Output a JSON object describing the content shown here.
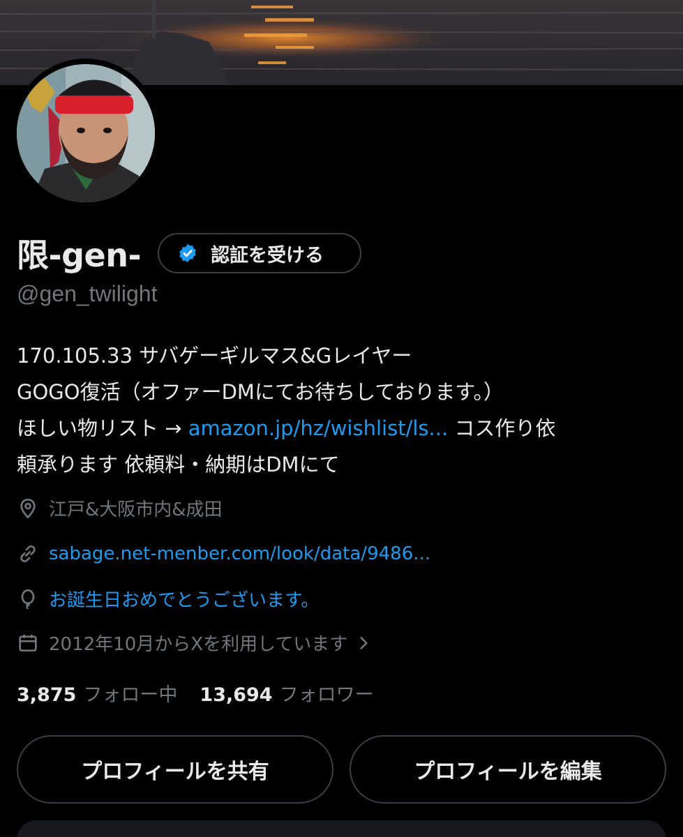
{
  "profile": {
    "display_name": "限-gen-",
    "verify_button_label": "認証を受ける",
    "handle": "@gen_twilight",
    "bio": {
      "line1": "170.105.33 サバゲーギルマス&Gレイヤー",
      "line2": "GOGO復活（オファーDMにてお待ちしております。）",
      "line3_prefix": "ほしい物リスト → ",
      "line3_link": "amazon.jp/hz/wishlist/ls...",
      "line3_suffix": " コス作り依",
      "line4": "頼承ります 依頼料・納期はDMにて"
    },
    "location": "江戸&大阪市内&成田",
    "website": "sabage.net-menber.com/look/data/9486...",
    "birthday": "お誕生日おめでとうございます。",
    "joined": "2012年10月からXを利用しています",
    "following_count": "3,875",
    "following_label": "フォロー中",
    "followers_count": "13,694",
    "followers_label": "フォロワー"
  },
  "actions": {
    "share_label": "プロフィールを共有",
    "edit_label": "プロフィールを編集"
  },
  "icons": {
    "location": "location-pin-icon",
    "website": "link-icon",
    "birthday": "balloon-icon",
    "joined": "calendar-icon",
    "joined_chevron": "chevron-right-icon",
    "verify": "verified-badge-icon"
  },
  "colors": {
    "background": "#000000",
    "text": "#e7e9ea",
    "muted": "#71767b",
    "link": "#1d9bf0",
    "border": "#3a3f44"
  }
}
